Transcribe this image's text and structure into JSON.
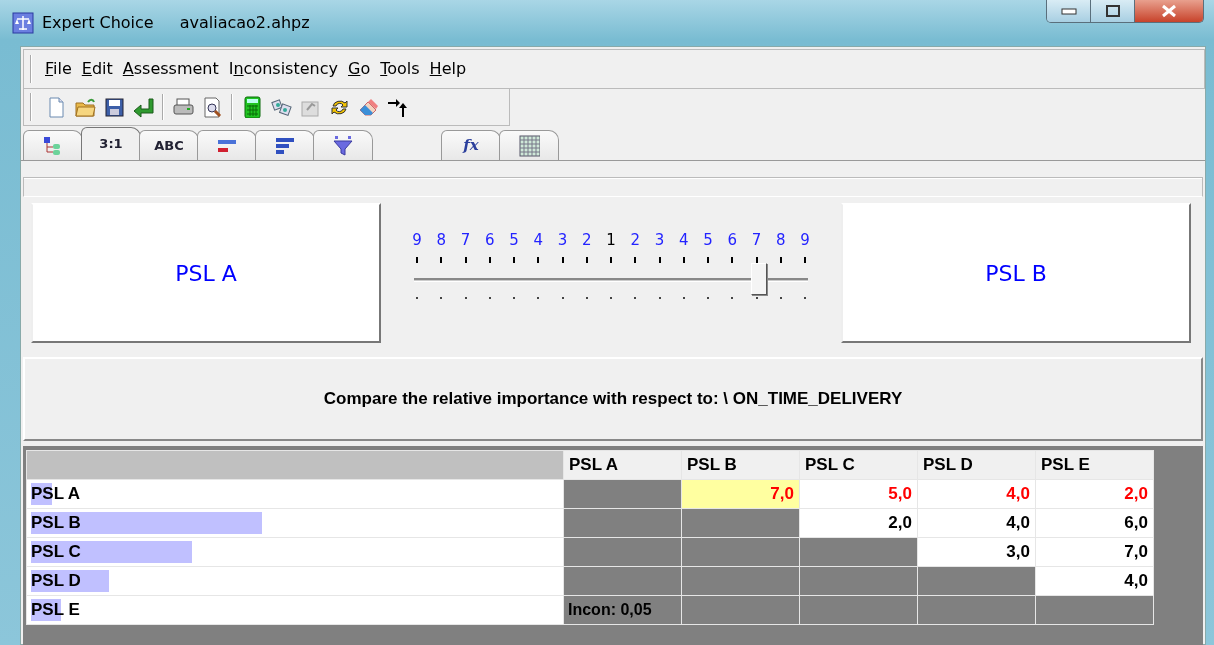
{
  "window": {
    "title": "Expert Choice",
    "file": "avaliacao2.ahpz"
  },
  "menu": [
    {
      "label": "File",
      "kind": "first"
    },
    {
      "label": "Edit",
      "kind": "first"
    },
    {
      "label": "Assessment",
      "kind": "first"
    },
    {
      "label": "Inconsistency",
      "kind": "second"
    },
    {
      "label": "Go",
      "kind": "first"
    },
    {
      "label": "Tools",
      "kind": "first"
    },
    {
      "label": "Help",
      "kind": "first"
    }
  ],
  "tabs": [
    {
      "kind": "icon",
      "selected": false
    },
    {
      "kind": "text",
      "label": "3:1",
      "selected": true
    },
    {
      "kind": "text",
      "label": "ABC",
      "selected": false
    },
    {
      "kind": "icon",
      "selected": false
    },
    {
      "kind": "icon",
      "selected": false
    },
    {
      "kind": "icon",
      "selected": false
    },
    {
      "kind": "blank",
      "selected": false
    },
    {
      "kind": "formula",
      "label": "fx",
      "selected": false
    },
    {
      "kind": "icon",
      "selected": false
    }
  ],
  "comparison": {
    "left": "PSL A",
    "right": "PSL B",
    "scale": [
      {
        "label": "9",
        "kind": "side"
      },
      {
        "label": "8",
        "kind": "side"
      },
      {
        "label": "7",
        "kind": "side"
      },
      {
        "label": "6",
        "kind": "side"
      },
      {
        "label": "5",
        "kind": "side"
      },
      {
        "label": "4",
        "kind": "side"
      },
      {
        "label": "3",
        "kind": "side"
      },
      {
        "label": "2",
        "kind": "side"
      },
      {
        "label": "1",
        "kind": "equal"
      },
      {
        "label": "2",
        "kind": "side"
      },
      {
        "label": "3",
        "kind": "side"
      },
      {
        "label": "4",
        "kind": "side"
      },
      {
        "label": "5",
        "kind": "side"
      },
      {
        "label": "6",
        "kind": "side"
      },
      {
        "label": "7",
        "kind": "side"
      },
      {
        "label": "8",
        "kind": "side"
      },
      {
        "label": "9",
        "kind": "side"
      }
    ],
    "slider": {
      "level": 0.875
    }
  },
  "prompt": "Compare the relative importance with respect to:  \\ ON_TIME_DELIVERY",
  "matrix": {
    "columns": [
      "PSL A",
      "PSL B",
      "PSL C",
      "PSL D",
      "PSL E"
    ],
    "rows": [
      {
        "label": "PSL A",
        "level": 0.04,
        "cells": [
          {
            "kind": "blank"
          },
          {
            "kind": "value",
            "text": "7,0",
            "selected": true,
            "inverse": true
          },
          {
            "kind": "value",
            "text": "5,0",
            "selected": false,
            "inverse": true
          },
          {
            "kind": "value",
            "text": "4,0",
            "selected": false,
            "inverse": true
          },
          {
            "kind": "value",
            "text": "2,0",
            "selected": false,
            "inverse": true
          }
        ]
      },
      {
        "label": "PSL B",
        "level": 0.43,
        "cells": [
          {
            "kind": "blank"
          },
          {
            "kind": "blank"
          },
          {
            "kind": "value",
            "text": "2,0",
            "selected": false,
            "inverse": false
          },
          {
            "kind": "value",
            "text": "4,0",
            "selected": false,
            "inverse": false
          },
          {
            "kind": "value",
            "text": "6,0",
            "selected": false,
            "inverse": false
          }
        ]
      },
      {
        "label": "PSL C",
        "level": 0.3,
        "cells": [
          {
            "kind": "blank"
          },
          {
            "kind": "blank"
          },
          {
            "kind": "blank"
          },
          {
            "kind": "value",
            "text": "3,0",
            "selected": false,
            "inverse": false
          },
          {
            "kind": "value",
            "text": "7,0",
            "selected": false,
            "inverse": false
          }
        ]
      },
      {
        "label": "PSL D",
        "level": 0.145,
        "cells": [
          {
            "kind": "blank"
          },
          {
            "kind": "blank"
          },
          {
            "kind": "blank"
          },
          {
            "kind": "blank"
          },
          {
            "kind": "value",
            "text": "4,0",
            "selected": false,
            "inverse": false
          }
        ]
      },
      {
        "label": "PSL E",
        "level": 0.056,
        "cells": [
          {
            "kind": "note",
            "text": "Incon: 0,05"
          },
          {
            "kind": "blank"
          },
          {
            "kind": "blank"
          },
          {
            "kind": "blank"
          },
          {
            "kind": "blank"
          }
        ]
      }
    ]
  }
}
